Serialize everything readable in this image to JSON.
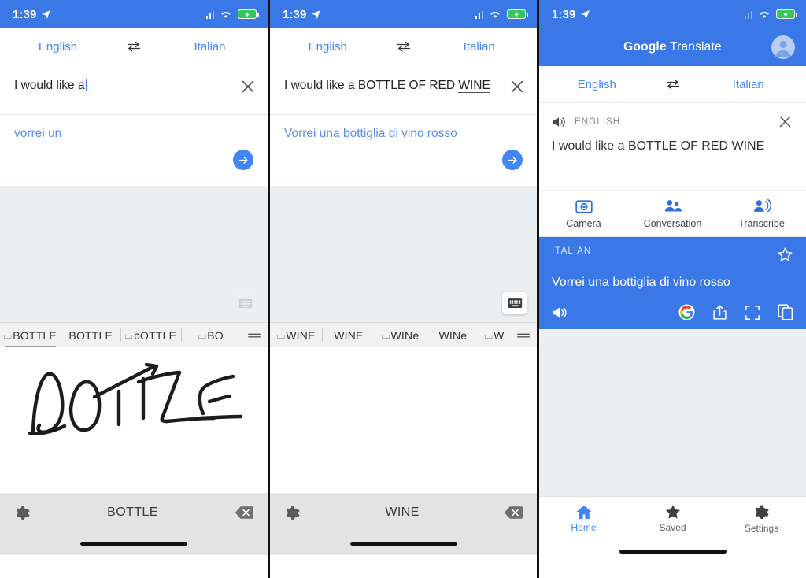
{
  "status_bar": {
    "time": "1:39",
    "location_icon": "location-arrow-icon",
    "signal_icon": "cellular-signal-icon",
    "wifi_icon": "wifi-icon",
    "battery_icon": "battery-charging-icon"
  },
  "colors": {
    "brand_blue": "#3b78e7",
    "link_blue": "#4285f4",
    "translated_blue": "#5b8def",
    "grey_bg": "#eceff1",
    "keyboard_bg": "#e3e3e3"
  },
  "panel1": {
    "language_from": "English",
    "language_to": "Italian",
    "swap_icon": "swap-horizontal-icon",
    "clear_icon": "close-icon",
    "source_text": "I would like a",
    "translated_text": "vorrei un",
    "submit_icon": "arrow-right-icon",
    "keyboard_toggle_icon": "keyboard-icon",
    "suggestions": [
      {
        "space": "⌴",
        "word": "BOTTLE",
        "active": true
      },
      {
        "space": "",
        "word": "BOTTLE",
        "active": false
      },
      {
        "space": "⌴",
        "word": "bOTTLE",
        "active": false
      },
      {
        "space": "⌴",
        "word": "BO",
        "active": false
      }
    ],
    "suggestions_menu_icon": "menu-icon",
    "handwriting_word": "BOTTLE",
    "settings_icon": "gear-icon",
    "backspace_icon": "backspace-icon",
    "bottom_label": "BOTTLE"
  },
  "panel2": {
    "language_from": "English",
    "language_to": "Italian",
    "swap_icon": "swap-horizontal-icon",
    "clear_icon": "close-icon",
    "source_text_committed": "I would like a BOTTLE OF RED ",
    "source_text_composing": "WINE",
    "translated_text": "Vorrei una bottiglia di vino rosso",
    "submit_icon": "arrow-right-icon",
    "keyboard_toggle_icon": "keyboard-icon",
    "suggestions": [
      {
        "space": "⌴",
        "word": "WINE",
        "active": false
      },
      {
        "space": "",
        "word": "WINE",
        "active": false
      },
      {
        "space": "⌴",
        "word": "WINe",
        "active": false
      },
      {
        "space": "",
        "word": "WINe",
        "active": false
      },
      {
        "space": "⌴",
        "word": "W",
        "active": false
      }
    ],
    "suggestions_menu_icon": "menu-icon",
    "settings_icon": "gear-icon",
    "backspace_icon": "backspace-icon",
    "bottom_label": "WINE"
  },
  "panel3": {
    "app_title_bold": "Google",
    "app_title_light": " Translate",
    "account_icon": "account-avatar-icon",
    "language_from": "English",
    "language_to": "Italian",
    "swap_icon": "swap-horizontal-icon",
    "source_lang_label": "ENGLISH",
    "source_speaker_icon": "volume-icon",
    "close_icon": "close-icon",
    "source_text": "I would like a BOTTLE OF RED WINE",
    "actions": [
      {
        "label": "Camera",
        "icon": "camera-icon"
      },
      {
        "label": "Conversation",
        "icon": "conversation-icon"
      },
      {
        "label": "Transcribe",
        "icon": "transcribe-icon"
      }
    ],
    "result_lang_label": "ITALIAN",
    "result_star_icon": "star-outline-icon",
    "result_text": "Vorrei una bottiglia di vino rosso",
    "result_speaker_icon": "volume-icon",
    "result_icons": [
      "google-g-icon",
      "share-icon",
      "fullscreen-icon",
      "copy-icon"
    ],
    "nav": [
      {
        "label": "Home",
        "icon": "home-icon",
        "active": true
      },
      {
        "label": "Saved",
        "icon": "star-icon",
        "active": false
      },
      {
        "label": "Settings",
        "icon": "gear-icon",
        "active": false
      }
    ]
  }
}
